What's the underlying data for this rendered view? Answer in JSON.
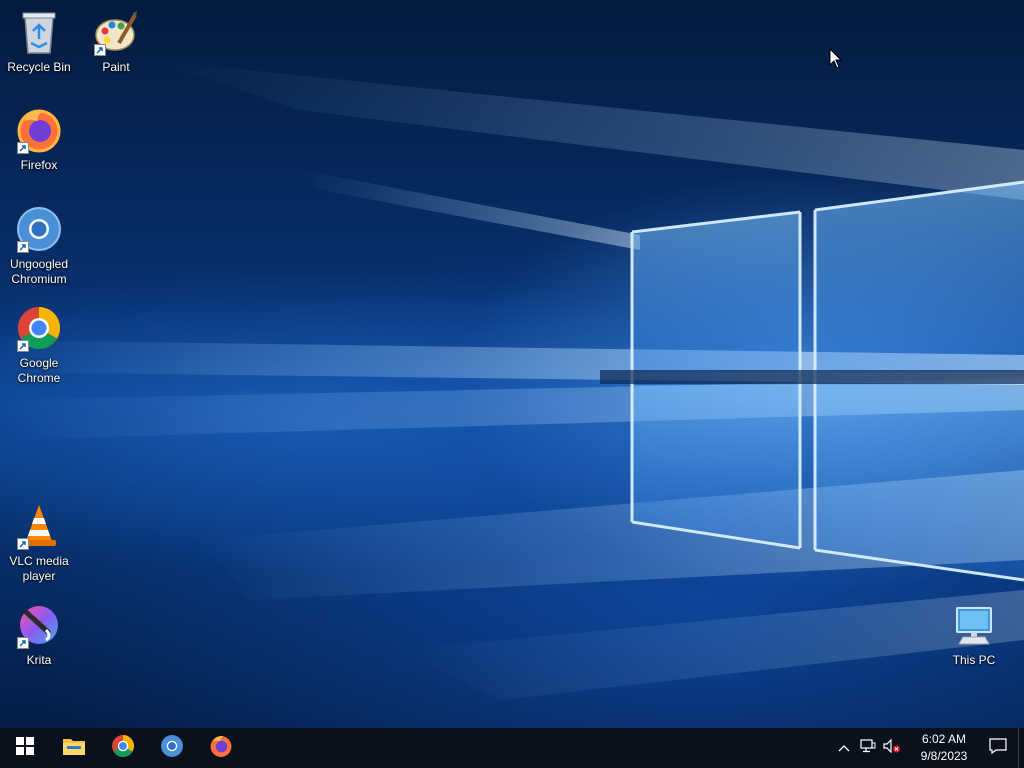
{
  "desktop": {
    "icons": [
      {
        "label": "Recycle Bin",
        "icon": "recycle-bin-icon"
      },
      {
        "label": "Paint",
        "icon": "paint-icon"
      },
      {
        "label": "Firefox",
        "icon": "firefox-icon"
      },
      {
        "label": "Ungoogled Chromium",
        "icon": "chromium-icon"
      },
      {
        "label": "Google Chrome",
        "icon": "chrome-icon"
      },
      {
        "label": "VLC media player",
        "icon": "vlc-icon"
      },
      {
        "label": "Krita",
        "icon": "krita-icon"
      },
      {
        "label": "This PC",
        "icon": "this-pc-icon"
      }
    ]
  },
  "taskbar": {
    "start": {
      "icon": "windows-start-icon"
    },
    "pinned": [
      {
        "icon": "file-explorer-icon"
      },
      {
        "icon": "chrome-icon"
      },
      {
        "icon": "chromium-icon"
      },
      {
        "icon": "firefox-icon"
      }
    ],
    "tray": {
      "icons": [
        "chevron-up-icon",
        "network-icon",
        "volume-muted-icon"
      ],
      "time": "6:02 AM",
      "date": "9/8/2023",
      "notification_icon": "action-center-icon"
    }
  },
  "colors": {
    "taskbar_bg": "#0b111c",
    "desktop_accent": "#0a3f8c"
  }
}
